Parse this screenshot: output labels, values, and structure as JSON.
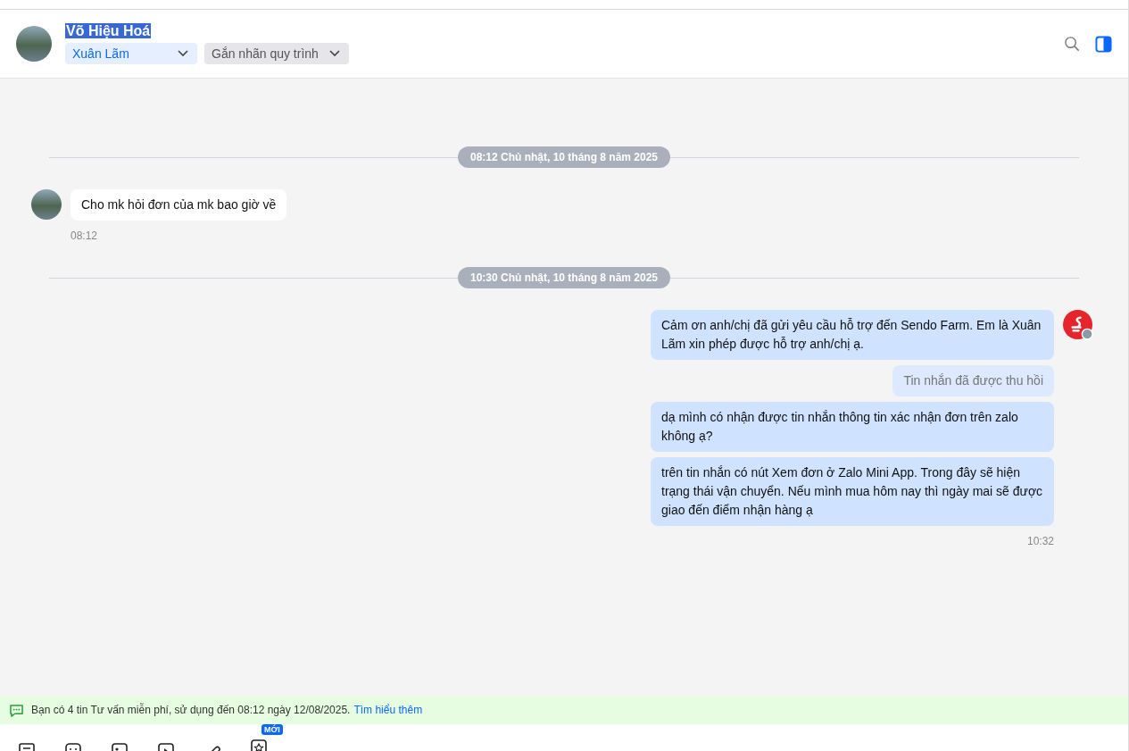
{
  "header": {
    "name": "Võ Hiệu Hoá",
    "name_highlighted": true,
    "assignee": "Xuân Lãm",
    "tag_dropdown": "Gắn nhãn quy trình"
  },
  "conversation": [
    {
      "kind": "divider",
      "text": "08:12 Chủ nhật, 10 tháng 8 năm 2025"
    },
    {
      "kind": "incoming",
      "messages": [
        {
          "kind": "text",
          "text": "Cho mk hỏi đơn của mk bao giờ về"
        }
      ],
      "time": "08:12"
    },
    {
      "kind": "divider",
      "text": "10:30 Chủ nhật, 10 tháng 8 năm 2025"
    },
    {
      "kind": "outgoing",
      "messages": [
        {
          "kind": "text",
          "text": "Cảm ơn anh/chị đã gửi yêu cầu hỗ trợ đến Sendo Farm. Em là Xuân Lãm xin phép được hỗ trợ anh/chị ạ."
        },
        {
          "kind": "recalled",
          "text": "Tin nhắn đã được thu hồi"
        },
        {
          "kind": "text",
          "text": "dạ mình có nhận được tin nhắn thông tin xác nhận đơn trên zalo không ạ?"
        },
        {
          "kind": "text",
          "text": "trên tin nhắn có nút Xem đơn ở Zalo Mini App. Trong đây sẽ hiện trạng thái vận chuyển. Nếu mình mua hôm nay thì ngày mai sẽ được giao đến điểm nhận hàng ạ"
        }
      ],
      "time": "10:32"
    }
  ],
  "notice": {
    "text": "Bạn có 4 tin Tư vấn miễn phí, sử dụng đến 08:12 ngày 12/08/2025.",
    "link": "Tìm hiểu thêm"
  },
  "toolbar": {
    "badge": "MỚI"
  }
}
